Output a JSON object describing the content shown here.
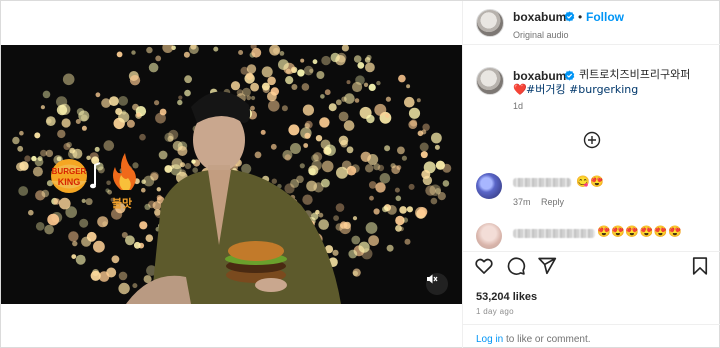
{
  "post": {
    "author": "boxabum",
    "follow_label": "Follow",
    "separator": "•",
    "audio_label": "Original audio",
    "caption": {
      "text": "퀴트로치즈비프리구와퍼",
      "heart": "❤️",
      "hashtags": "#버거킹 #burgerking",
      "time": "1d"
    },
    "media": {
      "brand_top": "BURGER",
      "brand_bottom": "KING",
      "overlay_text": "불맛"
    },
    "comments": [
      {
        "emojis": "😋😍",
        "time": "37m",
        "reply_label": "Reply"
      },
      {
        "emojis": "😍😍😍😍😍😍",
        "time": "",
        "reply_label": ""
      }
    ],
    "likes": "53,204 likes",
    "posted": "1 day ago",
    "login": {
      "link": "Log in",
      "rest": " to like or comment."
    }
  },
  "colors": {
    "accent": "#0095f6",
    "heart": "#ed4956",
    "text": "#262626",
    "muted": "#737373"
  },
  "icons": [
    "verified-badge-icon",
    "add-comment-icon",
    "heart-icon",
    "comment-icon",
    "share-icon",
    "bookmark-icon",
    "mute-icon"
  ]
}
